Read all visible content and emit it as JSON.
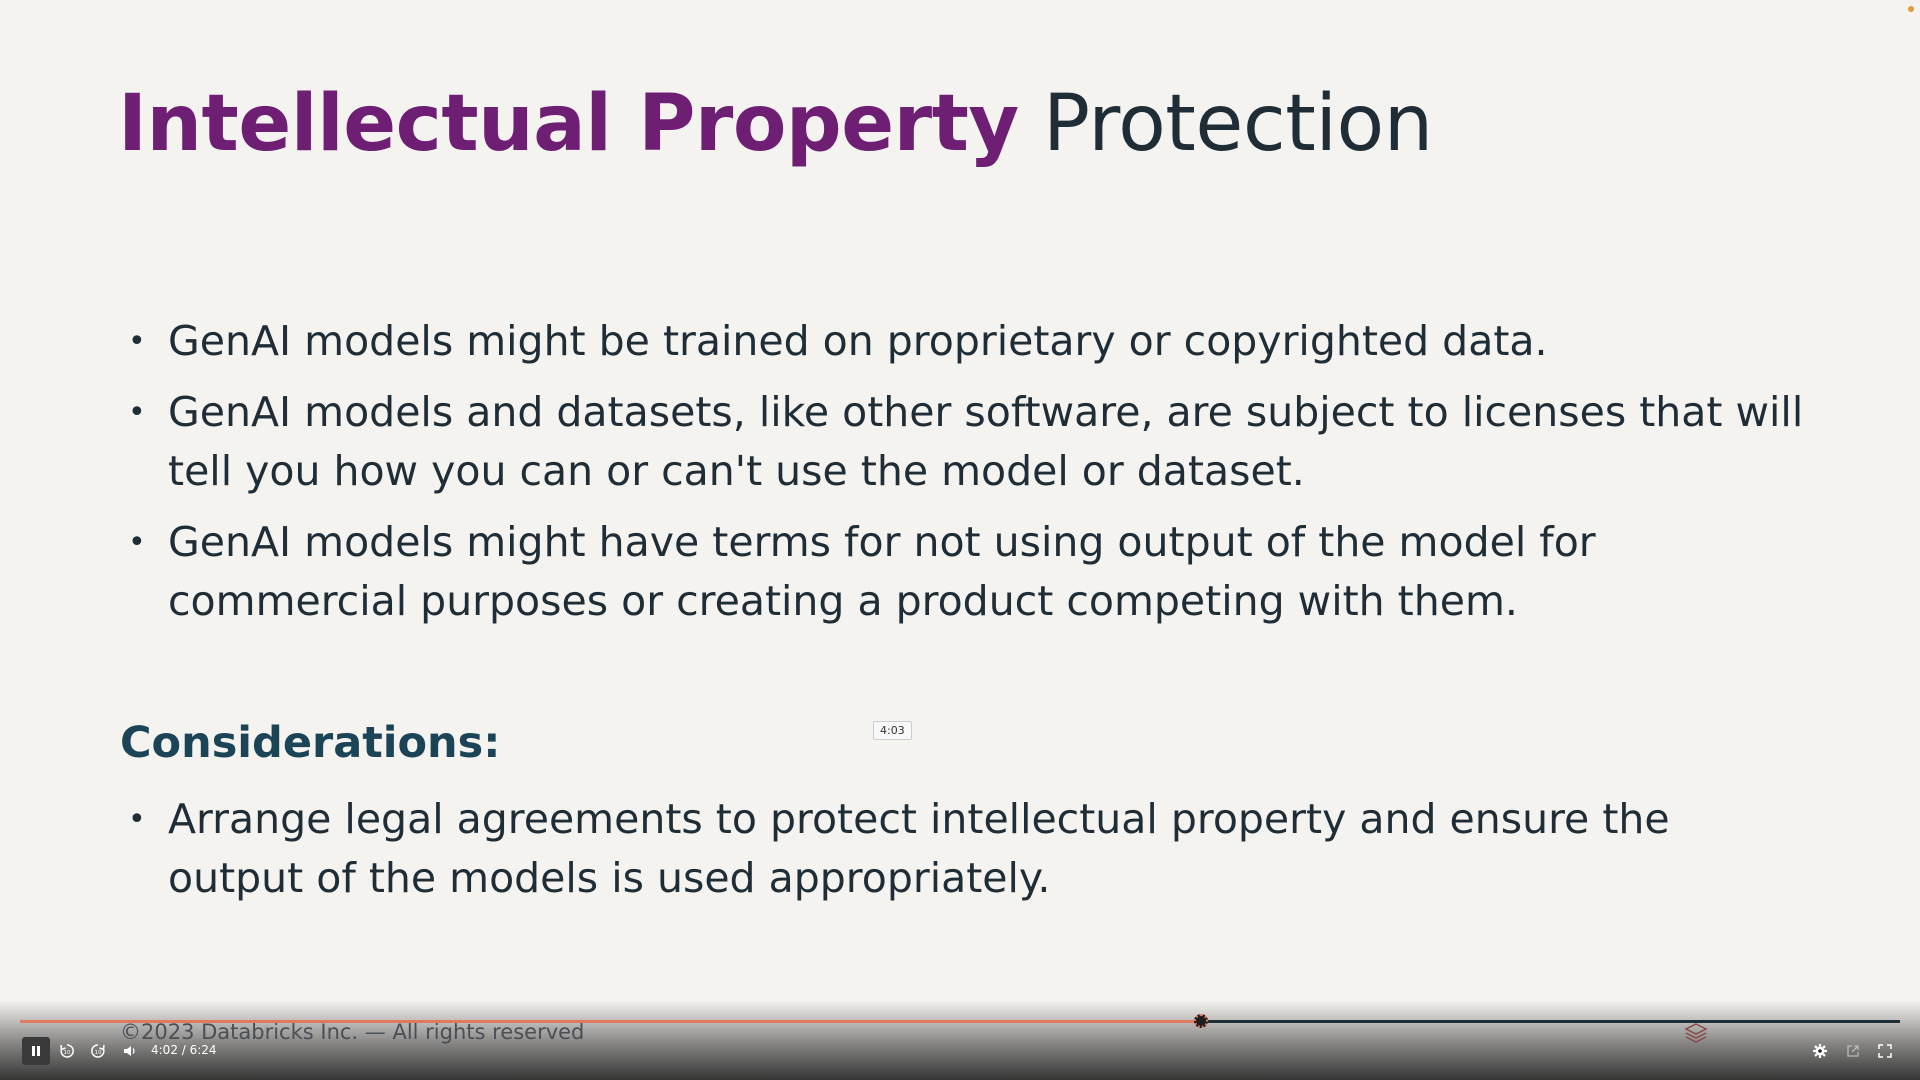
{
  "slide": {
    "title_highlight": "Intellectual Property",
    "title_rest": "Protection",
    "bullets": [
      "GenAI models might be trained on proprietary or copyrighted data.",
      "GenAI models and datasets, like other software, are subject to licenses that will tell you how you can or can't use the model or dataset.",
      "GenAI models might have terms for not using output of the model for commercial purposes or creating a product competing with them."
    ],
    "considerations_heading": "Considerations:",
    "considerations_bullets": [
      " Arrange legal agreements to protect intellectual property and ensure the output of the models is used appropriately."
    ],
    "bullet_glyph": "•",
    "footer": "©2023 Databricks Inc. — All rights reserved"
  },
  "player": {
    "hover_time": "4:03",
    "time_readout": "4:02 / 6:24",
    "progress_fraction": 0.628,
    "colors": {
      "progress": "#e07a5f",
      "track": "#1e2d36"
    },
    "icons": {
      "pause": "pause-icon",
      "rewind": "rewind-10-icon",
      "forward": "forward-10-icon",
      "volume": "volume-icon",
      "layers": "layers-icon",
      "settings": "settings-icon",
      "popout": "popout-icon",
      "fullscreen": "fullscreen-icon"
    }
  },
  "colors": {
    "title_highlight": "#6e1f74",
    "title_rest": "#1f2d36",
    "heading": "#1b4456",
    "body_text": "#1e2d36",
    "background": "#f5f3f0"
  }
}
